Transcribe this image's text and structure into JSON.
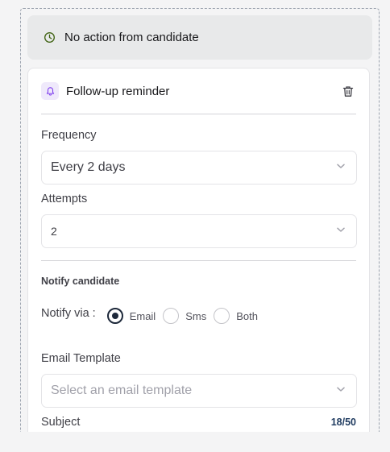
{
  "trigger": {
    "title": "No action from candidate",
    "icon": "clock-icon",
    "icon_color": "#65a30d"
  },
  "action": {
    "title": "Follow-up reminder",
    "icon": "bell-icon",
    "icon_color": "#7c3aed",
    "delete_icon": "trash-icon",
    "frequency": {
      "label": "Frequency",
      "value": "Every 2 days"
    },
    "attempts": {
      "label": "Attempts",
      "value": "2"
    },
    "notify": {
      "section_title": "Notify candidate",
      "via_label": "Notify via :",
      "options": [
        {
          "label": "Email",
          "selected": true
        },
        {
          "label": "Sms",
          "selected": false
        },
        {
          "label": "Both",
          "selected": false
        }
      ]
    },
    "email_template": {
      "label": "Email Template",
      "placeholder": "Select an email template"
    },
    "subject": {
      "label": "Subject",
      "counter": "18/50"
    }
  }
}
